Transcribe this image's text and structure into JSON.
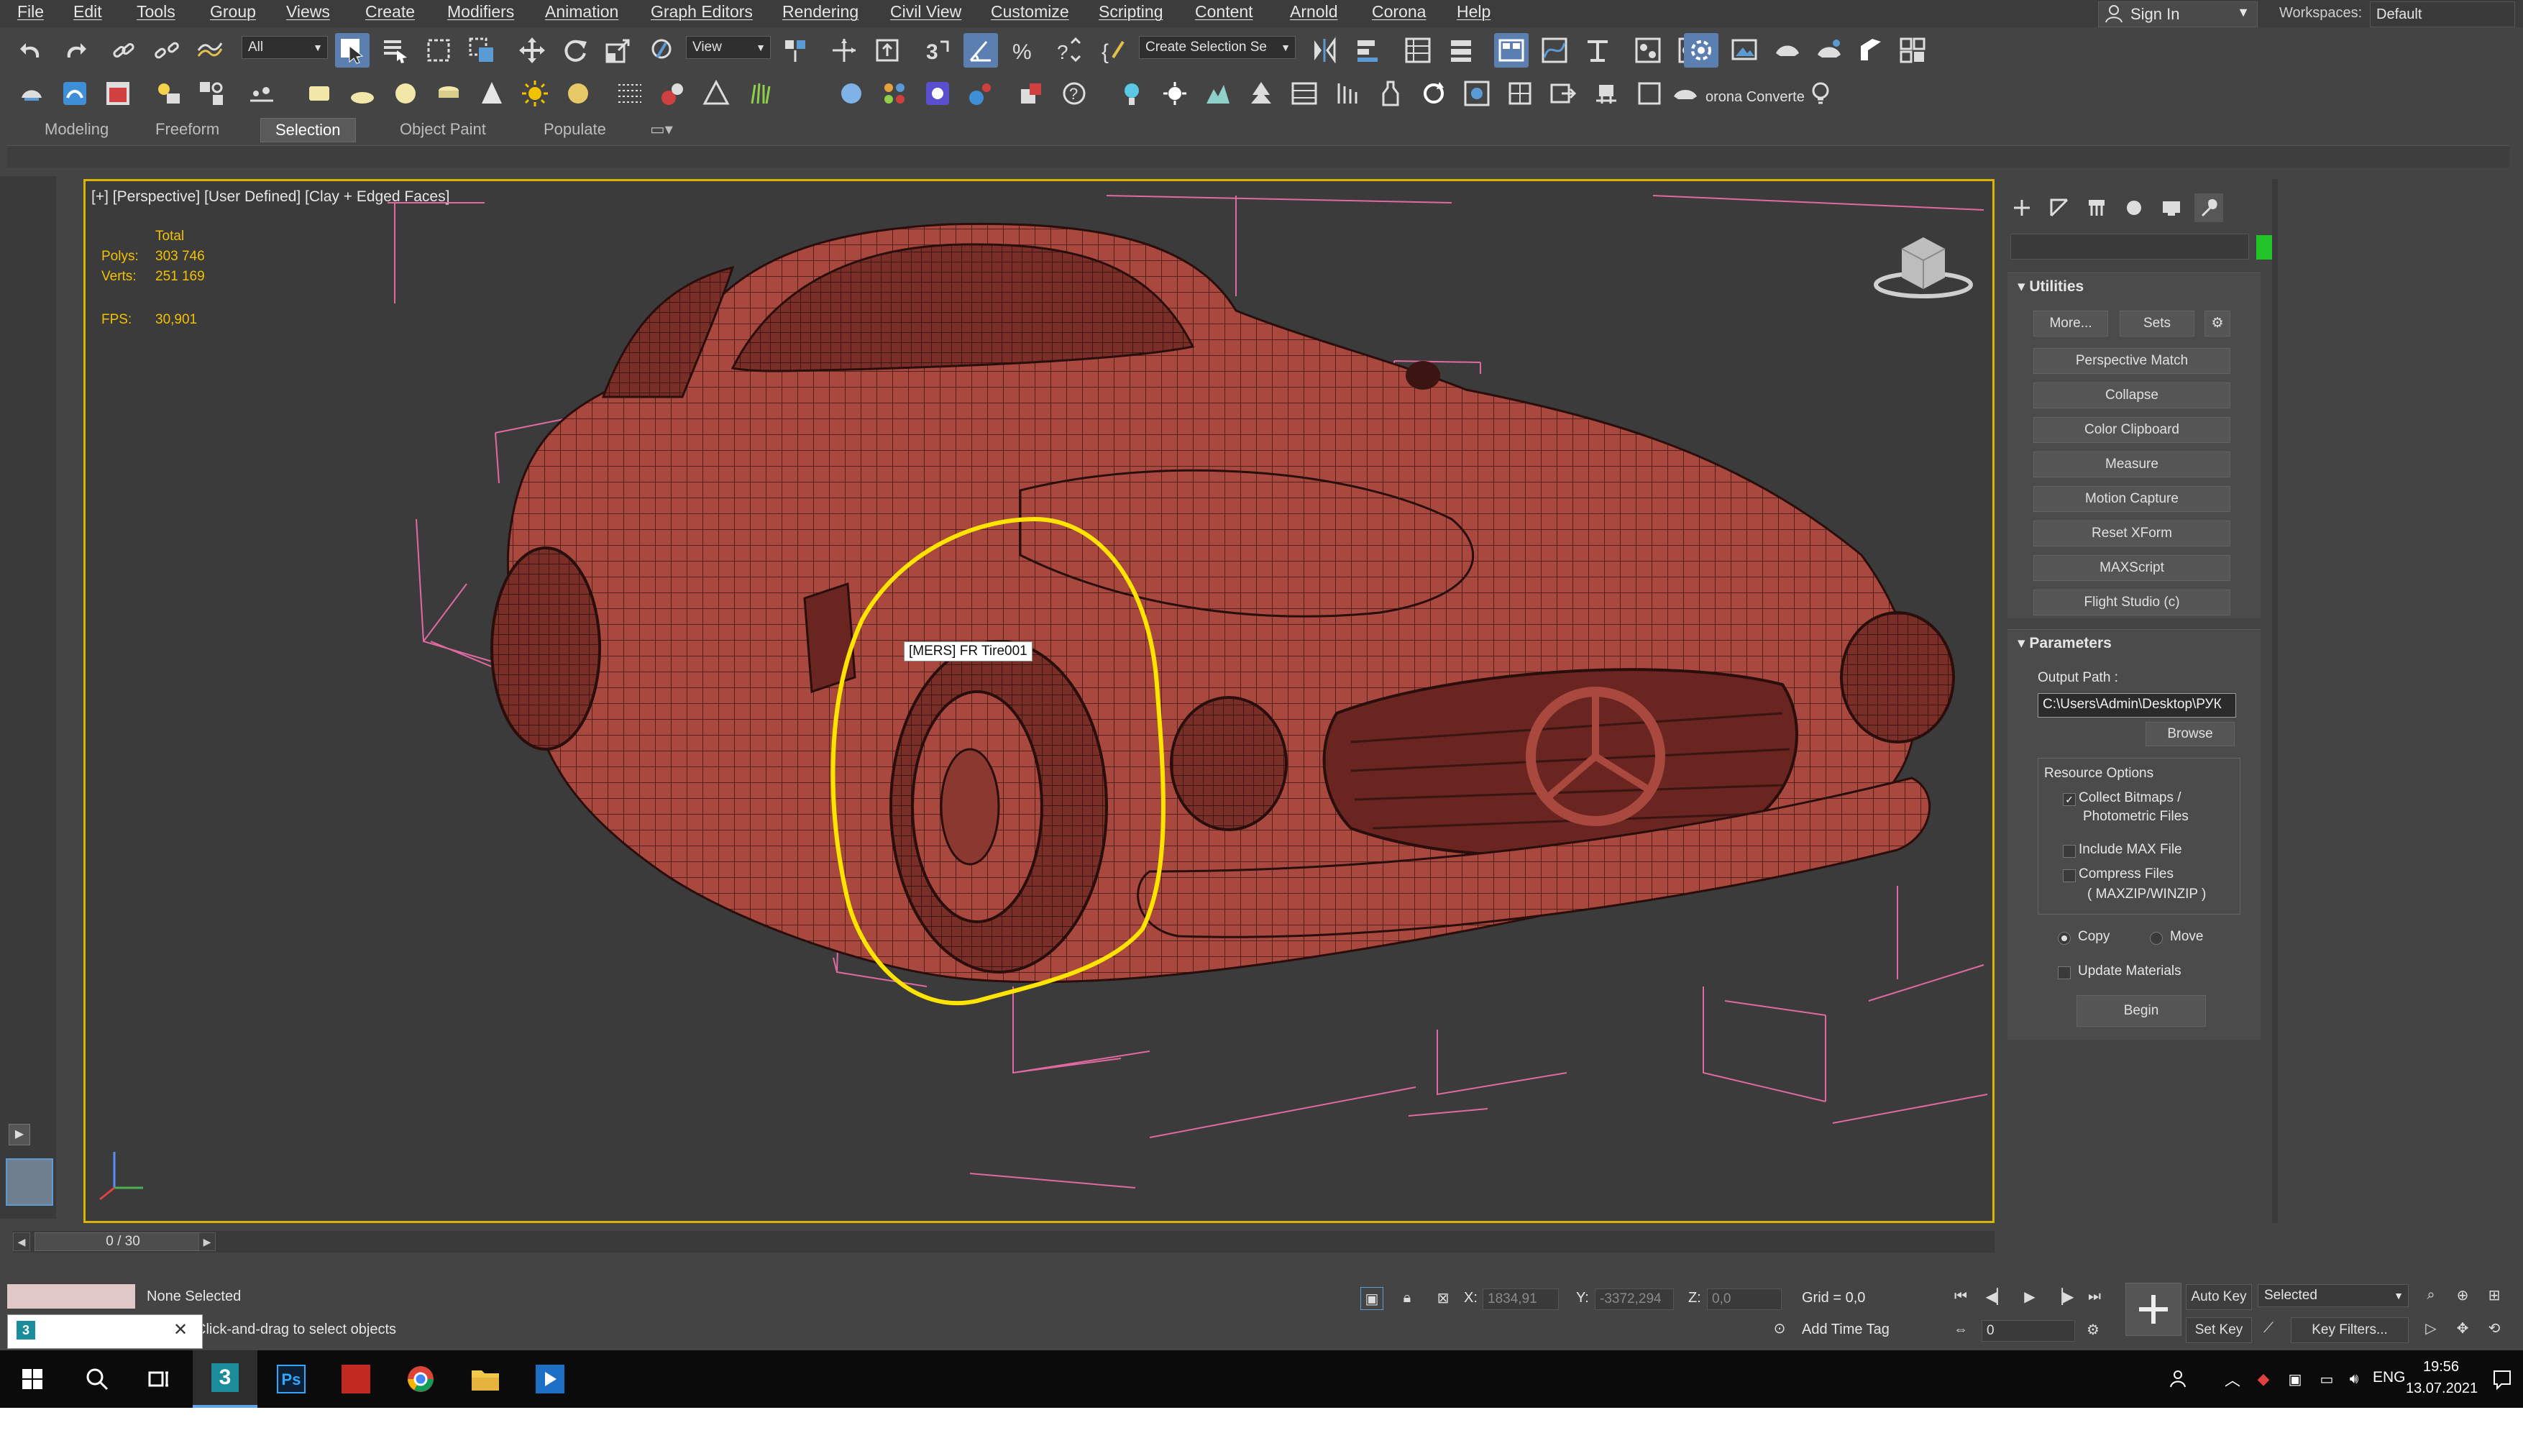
{
  "menu": [
    "File",
    "Edit",
    "Tools",
    "Group",
    "Views",
    "Create",
    "Modifiers",
    "Animation",
    "Graph Editors",
    "Rendering",
    "Civil View",
    "Customize",
    "Scripting",
    "Content",
    "Arnold",
    "Corona",
    "Help"
  ],
  "signin": {
    "label": "Sign In"
  },
  "workspace": {
    "label": "Workspaces:",
    "value": "Default"
  },
  "toolbar1": {
    "filter": "All",
    "view": "View",
    "selection_set": "Create Selection Se"
  },
  "toolbar2": {
    "corona_label": "orona Converte"
  },
  "ribbon_tabs": [
    "Modeling",
    "Freeform",
    "Selection",
    "Object Paint",
    "Populate"
  ],
  "ribbon_active": "Selection",
  "viewport": {
    "label": "[+] [Perspective] [User Defined] [Clay + Edged Faces]",
    "stats": {
      "total_label": "Total",
      "polys_label": "Polys:",
      "polys": "303 746",
      "verts_label": "Verts:",
      "verts": "251 169",
      "fps_label": "FPS:",
      "fps": "30,901"
    },
    "tooltip": "[MERS] FR Tire001"
  },
  "command_panel": {
    "utilities": {
      "title": "Utilities",
      "more": "More...",
      "sets": "Sets",
      "buttons": [
        "Perspective Match",
        "Collapse",
        "Color Clipboard",
        "Measure",
        "Motion Capture",
        "Reset XForm",
        "MAXScript",
        "Flight Studio (c)"
      ]
    },
    "parameters": {
      "title": "Parameters",
      "output_path_label": "Output Path :",
      "output_path": "C:\\Users\\Admin\\Desktop\\РУК",
      "browse": "Browse",
      "resource_options": "Resource Options",
      "collect_bitmaps": "Collect Bitmaps /",
      "photometric": "Photometric Files",
      "include_max": "Include MAX File",
      "compress": "Compress Files",
      "zip": "( MAXZIP/WINZIP )",
      "copy": "Copy",
      "move": "Move",
      "update_materials": "Update Materials",
      "begin": "Begin"
    }
  },
  "time_slider": {
    "value": "0 / 30"
  },
  "status": {
    "selection": "None Selected",
    "prompt": "Click-and-drag to select objects",
    "x_label": "X:",
    "x": "1834,91",
    "y_label": "Y:",
    "y": "-3372,294",
    "z_label": "Z:",
    "z": "0,0",
    "grid": "Grid = 0,0",
    "add_time_tag": "Add Time Tag",
    "auto_key": "Auto Key",
    "set_key": "Set Key",
    "selected": "Selected",
    "key_filters": "Key Filters...",
    "frame": "0"
  },
  "taskbar": {
    "lang": "ENG",
    "time": "19:56",
    "date": "13.07.2021"
  }
}
